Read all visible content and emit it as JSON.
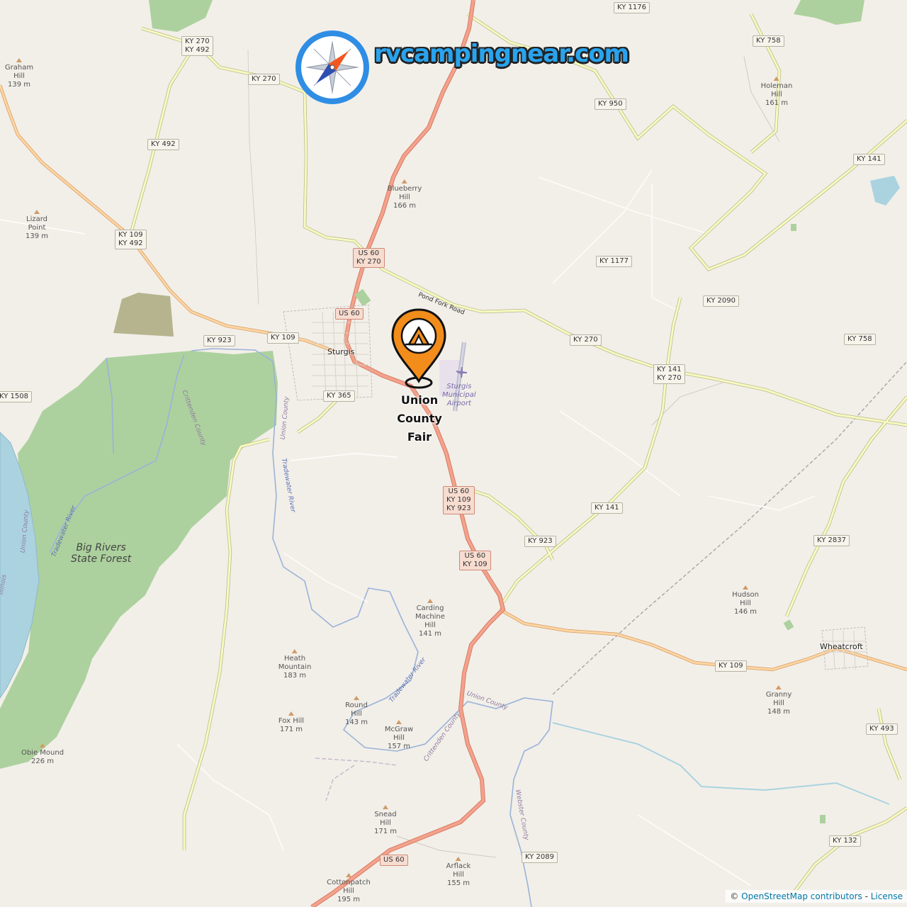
{
  "map": {
    "marker_label_lines": [
      "Union",
      "County",
      "Fair"
    ],
    "marker_icon": "campground-tent-icon",
    "marker_color": "#f28c1a",
    "brand_text": "rvcampingnear.com",
    "brand_icon": "compass-icon",
    "brand_color": "#29a3ee",
    "attribution_prefix": "©",
    "attribution_link": "OpenStreetMap contributors",
    "attribution_separator": "-",
    "attribution_license": "License",
    "river_color": "#aad3df",
    "forest_color": "#add19e",
    "primary_road_color": "#f4a28c",
    "secondary_road_color": "#f7fabf",
    "tertiary_road_color": "#f8c586"
  },
  "shields": [
    {
      "text": "KY 1176",
      "type": "ky"
    },
    {
      "text": "KY 270\nKY 492",
      "type": "ky"
    },
    {
      "text": "KY 270",
      "type": "ky"
    },
    {
      "text": "KY 758",
      "type": "ky"
    },
    {
      "text": "KY 950",
      "type": "ky"
    },
    {
      "text": "KY 492",
      "type": "ky"
    },
    {
      "text": "KY 141",
      "type": "ky"
    },
    {
      "text": "KY 109\nKY 492",
      "type": "ky"
    },
    {
      "text": "US 60\nKY 270",
      "type": "us"
    },
    {
      "text": "KY 1177",
      "type": "ky"
    },
    {
      "text": "KY 2090",
      "type": "ky"
    },
    {
      "text": "US 60",
      "type": "us"
    },
    {
      "text": "KY 923",
      "type": "ky"
    },
    {
      "text": "KY 109",
      "type": "ky"
    },
    {
      "text": "KY 270",
      "type": "ky"
    },
    {
      "text": "KY 758",
      "type": "ky"
    },
    {
      "text": "KY 141\nKY 270",
      "type": "ky"
    },
    {
      "text": "KY 365",
      "type": "ky"
    },
    {
      "text": "KY 1508",
      "type": "ky"
    },
    {
      "text": "US 60\nKY 109\nKY 923",
      "type": "us"
    },
    {
      "text": "KY 141",
      "type": "ky"
    },
    {
      "text": "KY 923",
      "type": "ky"
    },
    {
      "text": "KY 2837",
      "type": "ky"
    },
    {
      "text": "US 60\nKY 109",
      "type": "us"
    },
    {
      "text": "KY 109",
      "type": "ky"
    },
    {
      "text": "KY 493",
      "type": "ky"
    },
    {
      "text": "KY 132",
      "type": "ky"
    },
    {
      "text": "KY 2089",
      "type": "ky"
    },
    {
      "text": "US 60",
      "type": "us"
    }
  ],
  "peaks": [
    "Graham\nHill\n139 m",
    "Holeman\nHill\n161 m",
    "Blueberry\nHill\n166 m",
    "Lizard\nPoint\n139 m",
    "Carding\nMachine\nHill\n141 m",
    "Hudson\nHill\n146 m",
    "Heath\nMountain\n183 m",
    "Round\nHill\n143 m",
    "Granny\nHill\n148 m",
    "Fox Hill\n171 m",
    "McGraw\nHill\n157 m",
    "Obie Mound\n226 m",
    "Snead\nHill\n171 m",
    "Arflack\nHill\n155 m",
    "Cottonpatch\nHill\n195 m"
  ],
  "places": {
    "sturgis": "Sturgis",
    "wheatcroft": "Wheatcroft",
    "forest": "Big Rivers\nState Forest",
    "airport": "Sturgis\nMunicipal\nAirport",
    "pond_fork": "Pond Fork Road",
    "tradewater_1": "Tradewater River",
    "tradewater_2": "Tradewater River",
    "tradewater_3": "Tradewater River",
    "union_county_1": "Union County",
    "union_county_2": "Union County",
    "union_county_3": "Union County",
    "crittenden_1": "Crittenden County",
    "crittenden_2": "Crittenden County",
    "webster": "Webster County",
    "illinois": "Illinois"
  }
}
